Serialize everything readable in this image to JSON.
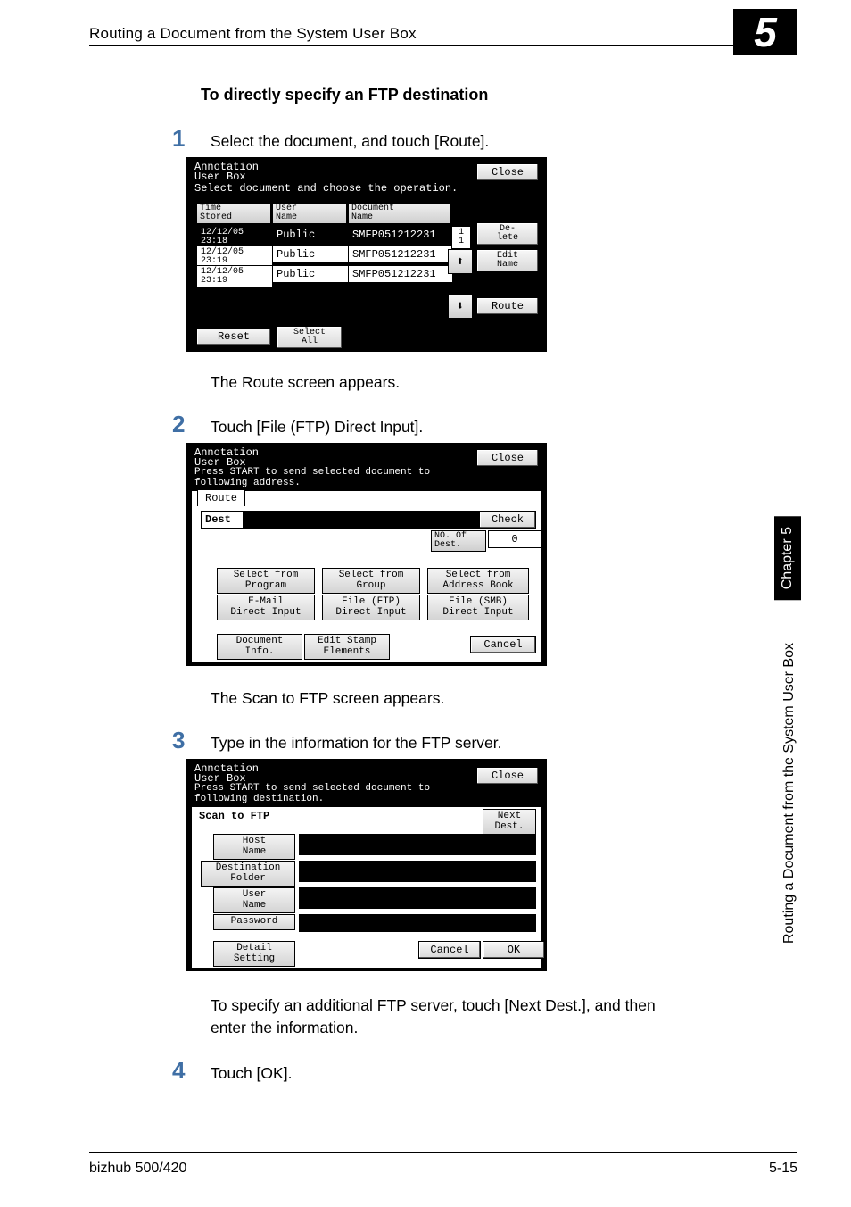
{
  "header": {
    "title": "Routing a Document from the System User Box",
    "badge": "5"
  },
  "sidebar": {
    "chapter": "Chapter 5",
    "long": "Routing a Document from the System User Box"
  },
  "footer": {
    "left": "bizhub 500/420",
    "right": "5-15"
  },
  "section_title": "To directly specify an FTP destination",
  "steps": {
    "s1": {
      "num": "1",
      "text": "Select the document, and touch [Route]."
    },
    "s1_caption": "The Route screen appears.",
    "s2": {
      "num": "2",
      "text": "Touch [File (FTP) Direct Input]."
    },
    "s2_caption": "The Scan to FTP screen appears.",
    "s3": {
      "num": "3",
      "text": "Type in the information for the FTP server."
    },
    "s3_caption": "To specify an additional FTP server, touch [Next Dest.], and then enter the information.",
    "s4": {
      "num": "4",
      "text": "Touch [OK]."
    }
  },
  "screen1": {
    "title1": "Annotation",
    "title2": "User Box",
    "subtitle": "Select document and choose the operation.",
    "close": "Close",
    "col_time": "Time\nStored",
    "col_user": "User\nName",
    "col_doc": "Document\nName",
    "row1_time": "12/12/05\n23:18",
    "row1_user": "Public",
    "row1_doc": "SMFP051212231",
    "row2_time": "12/12/05\n23:19",
    "row2_user": "Public",
    "row2_doc": "SMFP051212231",
    "row3_time": "12/12/05\n23:19",
    "row3_user": "Public",
    "row3_doc": "SMFP051212231",
    "page": "1\n1",
    "btn_delete": "De-\nlete",
    "btn_editname": "Edit\nName",
    "btn_route": "Route",
    "btn_reset": "Reset",
    "btn_selectall": "Select\nAll"
  },
  "screen2": {
    "title1": "Annotation",
    "title2": "User Box",
    "subtitle": "Press START to send selected document to\nfollowing address.",
    "close": "Close",
    "tab_route": "Route",
    "dest": "Dest",
    "check": "Check",
    "no_of_dest": "NO. Of\nDest.",
    "no_value": "0",
    "btn_program": "Select from\nProgram",
    "btn_group": "Select from\nGroup",
    "btn_addrbook": "Select from\nAddress Book",
    "btn_email": "E-Mail\nDirect Input",
    "btn_ftp": "File (FTP)\nDirect Input",
    "btn_smb": "File (SMB)\nDirect Input",
    "btn_docinfo": "Document\nInfo.",
    "btn_stamp": "Edit Stamp\nElements",
    "btn_cancel": "Cancel"
  },
  "screen3": {
    "title1": "Annotation",
    "title2": "User Box",
    "subtitle": "Press START to send selected document to\nfollowing destination.",
    "close": "Close",
    "heading": "Scan to FTP",
    "nextdest": "Next\nDest.",
    "hostname": "Host\nName",
    "destfolder": "Destination\nFolder",
    "username": "User\nName",
    "password": "Password",
    "detail": "Detail\nSetting",
    "cancel": "Cancel",
    "ok": "OK"
  }
}
